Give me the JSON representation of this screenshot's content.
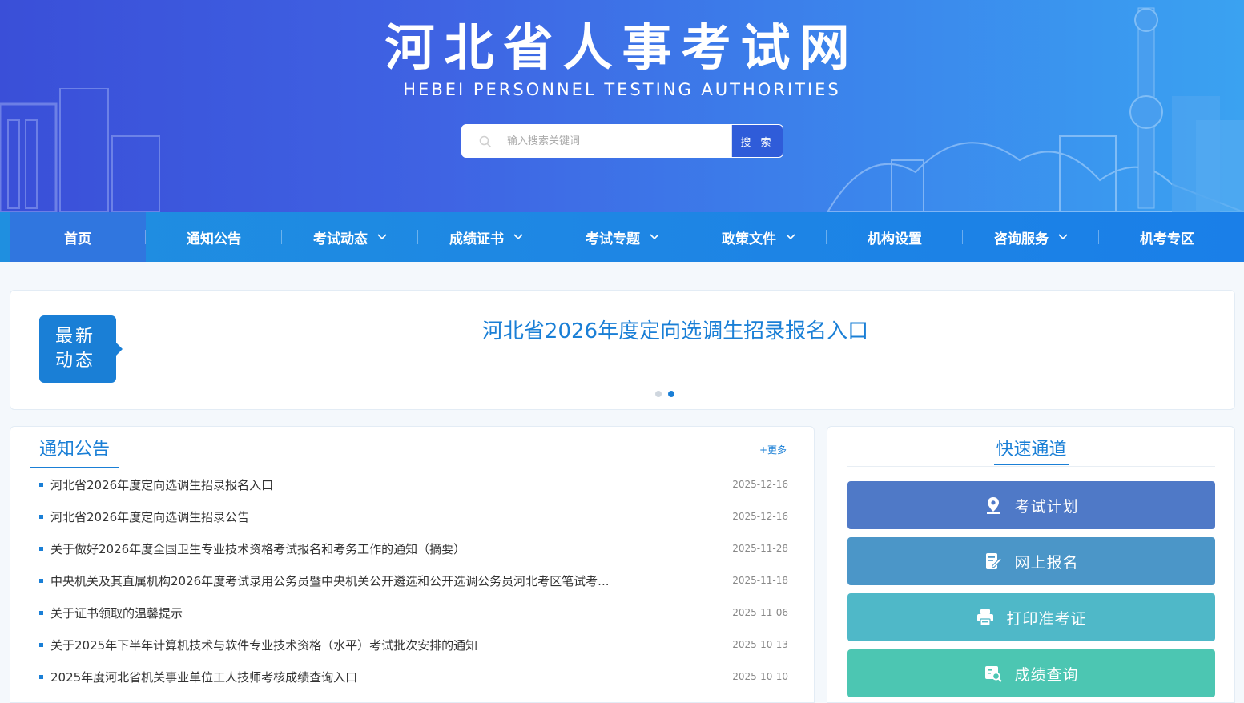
{
  "header": {
    "title": "河北省人事考试网",
    "subtitle": "HEBEI PERSONNEL TESTING AUTHORITIES"
  },
  "search": {
    "placeholder": "输入搜索关键词",
    "button_label": "搜 索",
    "icon": "search-icon"
  },
  "nav": {
    "items": [
      {
        "label": "首页",
        "has_dropdown": false,
        "active": true
      },
      {
        "label": "通知公告",
        "has_dropdown": false
      },
      {
        "label": "考试动态",
        "has_dropdown": true
      },
      {
        "label": "成绩证书",
        "has_dropdown": true
      },
      {
        "label": "考试专题",
        "has_dropdown": true
      },
      {
        "label": "政策文件",
        "has_dropdown": true
      },
      {
        "label": "机构设置",
        "has_dropdown": false
      },
      {
        "label": "咨询服务",
        "has_dropdown": true
      },
      {
        "label": "机考专区",
        "has_dropdown": false
      }
    ]
  },
  "latest": {
    "badge_line1": "最新",
    "badge_line2": "动态",
    "headline": "河北省2026年度定向选调生招录报名入口",
    "slide_count": 2,
    "active_slide": 2
  },
  "notices": {
    "title": "通知公告",
    "more_label": "+更多",
    "items": [
      {
        "title": "河北省2026年度定向选调生招录报名入口",
        "date": "2025-12-16"
      },
      {
        "title": "河北省2026年度定向选调生招录公告",
        "date": "2025-12-16"
      },
      {
        "title": "关于做好2026年度全国卫生专业技术资格考试报名和考务工作的通知（摘要）",
        "date": "2025-11-28"
      },
      {
        "title": "中央机关及其直属机构2026年度考试录用公务员暨中央机关公开遴选和公开选调公务员河北考区笔试考...",
        "date": "2025-11-18"
      },
      {
        "title": "关于证书领取的温馨提示",
        "date": "2025-11-06"
      },
      {
        "title": "关于2025年下半年计算机技术与软件专业技术资格（水平）考试批次安排的通知",
        "date": "2025-10-13"
      },
      {
        "title": "2025年度河北省机关事业单位工人技师考核成绩查询入口",
        "date": "2025-10-10"
      }
    ]
  },
  "quick": {
    "title": "快速通道",
    "buttons": [
      {
        "label": "考试计划",
        "icon": "location-pin-icon",
        "color": "#4f79c7"
      },
      {
        "label": "网上报名",
        "icon": "edit-form-icon",
        "color": "#4b96c8"
      },
      {
        "label": "打印准考证",
        "icon": "printer-icon",
        "color": "#4fb8c8"
      },
      {
        "label": "成绩查询",
        "icon": "score-search-icon",
        "color": "#4cc6b2"
      }
    ]
  },
  "colors": {
    "accent": "#1a7fd6",
    "banner_start": "#3a4fd8",
    "banner_end": "#3aa2f1",
    "nav": "#1e86e4"
  }
}
